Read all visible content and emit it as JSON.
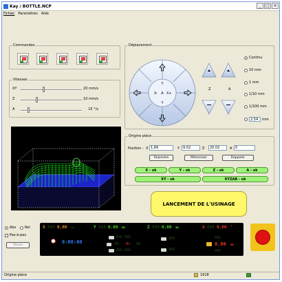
{
  "window": {
    "title": "Kay / BOTTLE.NCP",
    "buttons": [
      "_",
      "□",
      "×"
    ]
  },
  "menu": [
    "Fichier",
    "Paramètres",
    "Aide"
  ],
  "commandes": {
    "label": "Commandes",
    "icons": [
      "cmd-1-icon",
      "cmd-2-icon",
      "cmd-3-icon",
      "cmd-4-icon",
      "cmd-5-icon"
    ]
  },
  "vitesses": {
    "label": "Vitesses",
    "rows": [
      {
        "axis": "XY",
        "value": "20 mm/s",
        "level": 0.35
      },
      {
        "axis": "Z",
        "value": "10 mm/s",
        "level": 0.25
      },
      {
        "axis": "A",
        "value": "15 °/s",
        "level": 0.12
      }
    ]
  },
  "deplacement": {
    "label": "Déplacement",
    "jog": {
      "center": "A",
      "left": "X-",
      "right": "X+",
      "up": "Y",
      "down": "Y"
    },
    "side": {
      "z": "Z",
      "a": "A"
    },
    "steps": [
      {
        "label": "Continu",
        "checked": true
      },
      {
        "label": "10 mm",
        "checked": false
      },
      {
        "label": "1 mm",
        "checked": false
      },
      {
        "label": "1/10 mm",
        "checked": false
      },
      {
        "label": "1/100 mm",
        "checked": false
      },
      {
        "label": "mm",
        "checked": false,
        "value": "2.54"
      }
    ]
  },
  "origine": {
    "label": "Origine pièce",
    "position_label": "Position :",
    "fields": [
      {
        "prefix": "X",
        "value": "1.89"
      },
      {
        "prefix": "Y",
        "value": "9.02"
      },
      {
        "prefix": "Z",
        "value": "20.02"
      },
      {
        "prefix": "A",
        "value": "0"
      }
    ],
    "buttons": [
      "Rejoindre",
      "Mémoriser",
      "Rappeler"
    ],
    "ok_buttons": [
      "X - ok",
      "Y - ok",
      "Z - ok",
      "A - ok"
    ],
    "ok_buttons2": [
      "XY - ok",
      "XYZAB - ok"
    ]
  },
  "launch_label": "LANCEMENT DE L'USINAGE",
  "mode": {
    "abs": "Abs",
    "rel": "Rel",
    "step": "Pas-à-pas",
    "pause": "Pause"
  },
  "dro": {
    "x": {
      "axis": "X",
      "ghost": "888",
      "value": "0.00",
      "unit": "mm"
    },
    "y": {
      "axis": "Y",
      "ghost": "888",
      "value": "0.00",
      "unit": "mm"
    },
    "z": {
      "axis": "Z",
      "ghost": "888",
      "value": "0.00",
      "unit": "mm"
    },
    "a": {
      "axis": "A",
      "ghost": "888",
      "value": "0.00",
      "unit": "°"
    },
    "time": "0:00:00",
    "feed_top": "888 888",
    "mid_left": "-88",
    "mid_x": "-X-",
    "mid_right": "88",
    "feed_bottom": "888 888",
    "right_top": "888",
    "right_main": "0.00",
    "right_unit": "mm",
    "right_bottom": "888"
  },
  "statusbar": {
    "left": "Origine pièce",
    "mid": "1918"
  },
  "colors": {
    "launch": "#fff86a",
    "ok_green": "#9ef27a",
    "dro_x": "#e08a1d",
    "dro_y": "#3fd51d",
    "dro_z": "#3fd51d",
    "dro_a": "#e03a1d",
    "stop": "#e01212"
  }
}
